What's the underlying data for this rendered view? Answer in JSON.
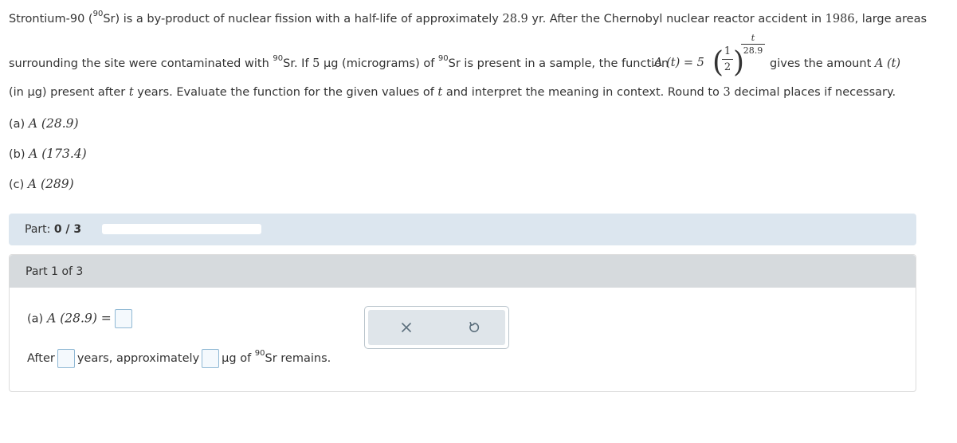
{
  "problem": {
    "l1_a": "Strontium-90 (",
    "l1_iso": "90",
    "l1_b": "Sr) is a by-product of nuclear fission with a half-life of approximately ",
    "l1_halflife": "28.9",
    "l1_c": " yr. After the Chernobyl nuclear reactor accident in ",
    "l1_year": "1986",
    "l1_d": ", large areas",
    "l2_a": "surrounding the site were contaminated with ",
    "l2_iso1": "90",
    "l2_b": "Sr. If ",
    "l2_mass": "5",
    "l2_c": " μg (micrograms) of ",
    "l2_iso2": "90",
    "l2_d": "Sr is present in a sample, the function ",
    "formula_lhs": "A (t) = 5",
    "formula_frac_num": "1",
    "formula_frac_den": "2",
    "formula_exp_num": "t",
    "formula_exp_den": "28.9",
    "l2_e": "gives the amount ",
    "l2_func": "A (t)",
    "l3_a": "(in μg) present after ",
    "l3_t1": "t",
    "l3_b": " years. Evaluate the function for the given values of ",
    "l3_t2": "t",
    "l3_c": " and interpret the meaning in context. Round to ",
    "l3_n": "3",
    "l3_d": " decimal places if necessary."
  },
  "questions": [
    {
      "label": "(a)",
      "expr": "A (28.9)"
    },
    {
      "label": "(b)",
      "expr": "A (173.4)"
    },
    {
      "label": "(c)",
      "expr": "A (289)"
    }
  ],
  "part_bar": {
    "prefix": "Part: ",
    "value": "0 / 3",
    "progress": 0
  },
  "panel": {
    "title": "Part 1 of 3",
    "answer_label": "(a)",
    "answer_expr": "A (28.9) =",
    "row2_after": "After",
    "row2_years": "years, approximately",
    "row2_ug": "μg of",
    "row2_iso": "90",
    "row2_end": "Sr remains."
  },
  "tools": {
    "clear": "×",
    "reset": "↺"
  },
  "colors": {
    "part_bar_bg": "#dce6ef",
    "panel_header_bg": "#d6dadd",
    "input_border": "#8fb8d4",
    "icon_color": "#5b6e7c"
  }
}
